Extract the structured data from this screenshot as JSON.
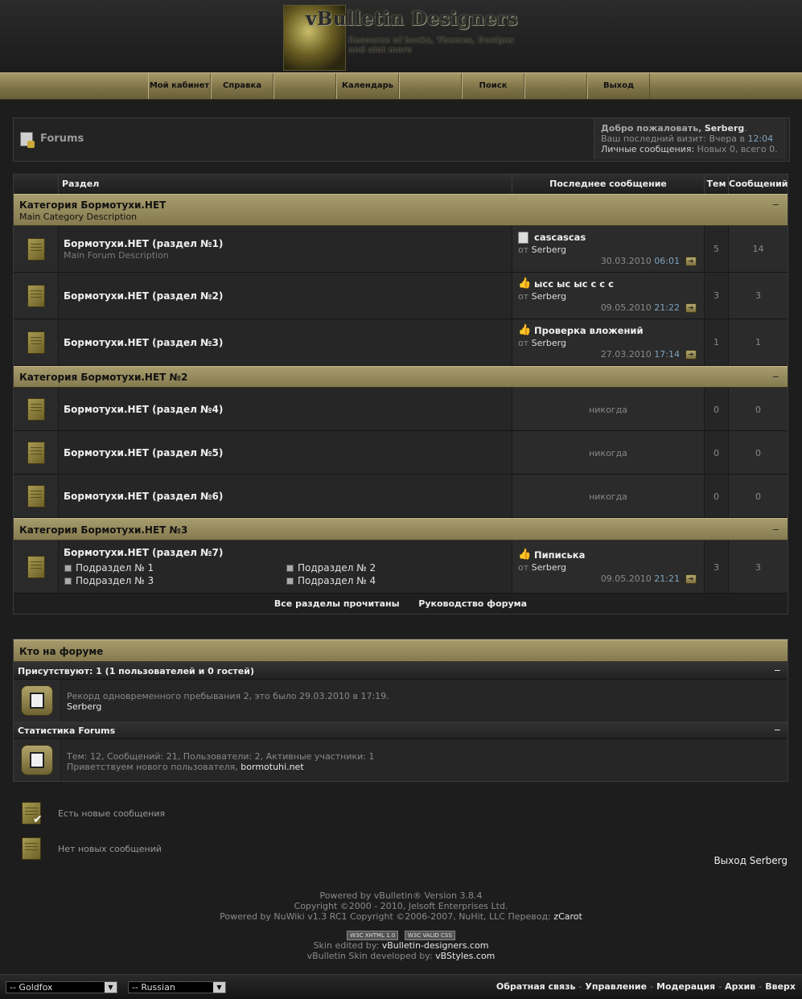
{
  "header": {
    "logo_title": "vBulletin Designers",
    "logo_subtitle": "Resource of hacks, Themes, Designs and alot more"
  },
  "navbar": [
    "Мой кабинет",
    "Справка",
    "",
    "Календарь",
    "",
    "Поиск",
    "",
    "Выход"
  ],
  "breadcrumb": {
    "title": "Forums"
  },
  "welcome": {
    "greeting": "Добро пожаловать,",
    "username": "Serberg",
    "last_visit_label": "Ваш последний визит: Вчера в",
    "last_visit_time": "12:04",
    "pm_label": "Личные сообщения:",
    "pm_value": "Новых 0, всего 0."
  },
  "table_headers": {
    "forum": "Раздел",
    "last_post": "Последнее сообщение",
    "threads": "Тем",
    "posts": "Сообщений"
  },
  "categories": [
    {
      "title": "Категория Бормотухи.НЕТ",
      "description": "Main Category Description",
      "collapse": "−"
    },
    {
      "title": "Категория Бормотухи.НЕТ №2",
      "description": "",
      "collapse": "−"
    },
    {
      "title": "Категория Бормотухи.НЕТ №3",
      "description": "",
      "collapse": "−"
    }
  ],
  "forums": [
    {
      "title": "Бормотухи.НЕТ (раздел №1)",
      "description": "Main Forum Description",
      "last_title": "cascascas",
      "last_icon": "document-icon",
      "by_label": "от",
      "last_by": "Serberg",
      "last_date": "30.03.2010",
      "last_time": "06:01",
      "threads": "5",
      "posts": "14"
    },
    {
      "title": "Бормотухи.НЕТ (раздел №2)",
      "description": "",
      "last_title": "ысс ыс ыс с с с",
      "last_icon": "thumbs-up-icon",
      "by_label": "от",
      "last_by": "Serberg",
      "last_date": "09.05.2010",
      "last_time": "21:22",
      "threads": "3",
      "posts": "3"
    },
    {
      "title": "Бормотухи.НЕТ (раздел №3)",
      "description": "",
      "last_title": "Проверка вложений",
      "last_icon": "thumbs-up-icon",
      "by_label": "от",
      "last_by": "Serberg",
      "last_date": "27.03.2010",
      "last_time": "17:14",
      "threads": "1",
      "posts": "1"
    },
    {
      "title": "Бормотухи.НЕТ (раздел №4)",
      "never": "никогда",
      "threads": "0",
      "posts": "0"
    },
    {
      "title": "Бормотухи.НЕТ (раздел №5)",
      "never": "никогда",
      "threads": "0",
      "posts": "0"
    },
    {
      "title": "Бормотухи.НЕТ (раздел №6)",
      "never": "никогда",
      "threads": "0",
      "posts": "0"
    },
    {
      "title": "Бормотухи.НЕТ (раздел №7)",
      "subforums": [
        "Подраздел № 1",
        "Подраздел № 2",
        "Подраздел № 3",
        "Подраздел № 4"
      ],
      "last_title": "Пиписька",
      "last_icon": "thumbs-up-icon",
      "by_label": "от",
      "last_by": "Serberg",
      "last_date": "09.05.2010",
      "last_time": "21:21",
      "threads": "3",
      "posts": "3"
    }
  ],
  "table_footer": {
    "mark_read": "Все разделы прочитаны",
    "guidelines": "Руководство форума"
  },
  "online": {
    "title": "Кто на форуме",
    "present": "Присутствуют: 1 (1 пользователей и 0 гостей)",
    "record": "Рекорд одновременного пребывания 2, это было 29.03.2010 в 17:19.",
    "users": "Serberg",
    "stats_title": "Статистика Forums",
    "stats": "Тем: 12, Сообщений: 21, Пользователи: 2, Активные участники: 1",
    "welcome_prefix": "Приветствуем нового пользователя,",
    "newest_user": "bormotuhi.net",
    "collapse": "−"
  },
  "legend": {
    "new_posts": "Есть новые сообщения",
    "no_new_posts": "Нет новых сообщений"
  },
  "logout_link": "Выход Serberg",
  "footer": {
    "powered": "Powered by vBulletin® Version 3.8.4",
    "copyright": "Copyright ©2000 - 2010, Jelsoft Enterprises Ltd.",
    "nuwiki": "Powered by NuWiki v1.3 RC1 Copyright ©2006-2007, NuHit, LLC Перевод:",
    "translator": "zCarot",
    "badge1_w3c": "W3C",
    "badge1_label": "XHTML 1.0",
    "badge2_w3c": "W3C",
    "badge2_label": "VALID CSS",
    "skin_edited_label": "Skin edited by:",
    "skin_edited": "vBulletin-designers.com",
    "skin_dev_label": "vBulletin Skin developed by:",
    "skin_dev": "vBStyles.com"
  },
  "bottom": {
    "style_select": "-- Goldfox",
    "lang_select": "-- Russian",
    "links": [
      "Обратная связь",
      "Управление",
      "Модерация",
      "Архив",
      "Вверх"
    ],
    "separator": "-"
  },
  "colors": {
    "accent": "#8a7f52",
    "link_blue": "#7ea2bd",
    "background": "#1d1d1d"
  }
}
